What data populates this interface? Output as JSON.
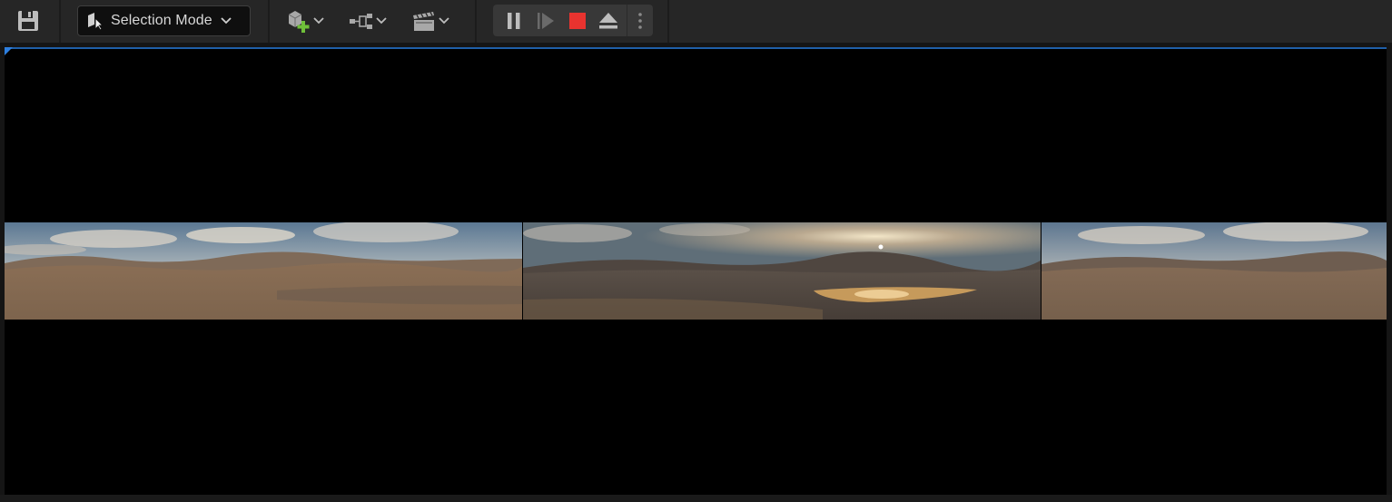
{
  "toolbar": {
    "selection_mode_label": "Selection Mode",
    "icons": {
      "save": "save-icon",
      "selection_mode": "select-cursor-icon",
      "quick_add": "add-actor-icon",
      "blueprints": "blueprint-icon",
      "cinematics": "clapperboard-icon",
      "pause": "pause-icon",
      "step": "frame-step-icon",
      "stop": "stop-icon",
      "eject": "eject-icon",
      "more": "more-options-icon"
    },
    "colors": {
      "accent_green": "#6fbf3a",
      "stop_red": "#e8332f",
      "viewport_accent": "#1f5fa8"
    }
  },
  "viewport": {
    "panels": [
      "panorama-left",
      "panorama-center",
      "panorama-right"
    ]
  }
}
